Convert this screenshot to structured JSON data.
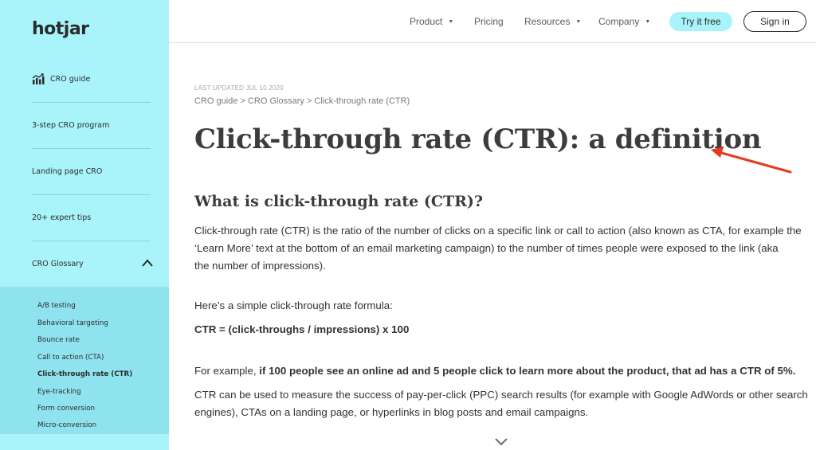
{
  "sidebar": {
    "logo": "hotjar",
    "items": [
      {
        "label": "CRO guide",
        "icon": "chart-icon"
      },
      {
        "label": "3-step CRO program"
      },
      {
        "label": "Landing page CRO"
      },
      {
        "label": "20+ expert tips"
      },
      {
        "label": "CRO Glossary",
        "icon": "chevron-up-icon"
      }
    ],
    "glossary": [
      "A/B testing",
      "Behavioral targeting",
      "Bounce rate",
      "Call to action (CTA)",
      "Click-through rate (CTR)",
      "Eye-tracking",
      "Form conversion",
      "Micro-conversion"
    ],
    "active_glossary_index": 4
  },
  "nav": {
    "product": "Product",
    "pricing": "Pricing",
    "resources": "Resources",
    "company": "Company",
    "try_free": "Try it free",
    "sign_in": "Sign in"
  },
  "article": {
    "last_updated": "LAST UPDATED JUL 10 2020",
    "breadcrumb": [
      "CRO guide",
      "CRO Glossary",
      "Click-through rate (CTR)"
    ],
    "breadcrumb_sep": ">",
    "title": "Click-through rate (CTR): a definition",
    "heading": "What is click-through rate (CTR)?",
    "p1_line1": "Click-through rate (CTR) is the ratio of the number of clicks on a specific link or call to action (also known as CTA, for example the",
    "p1_line2": "‘Learn More’ text at the bottom of an email marketing campaign) to the number of times people were exposed to the link (aka",
    "p1_line3": "the number of impressions).",
    "p2": "Here’s a simple click-through rate formula:",
    "formula": "CTR = (click-throughs / impressions) x 100",
    "p3_prefix": "For example, ",
    "p3_bold": "if 100 people see an online ad and 5 people click to learn more about the product, that ad has a CTR of 5%.",
    "p4_line1": "CTR can be used to measure the success of pay-per-click (PPC) search results (for example with Google AdWords or other search",
    "p4_line2": "engines), CTAs on a landing page, or hyperlinks in blog posts and email campaigns."
  },
  "colors": {
    "sidebar_bg": "#a9f4fb",
    "submenu_bg": "#8fe3ef",
    "annotation_arrow": "#e8391f"
  }
}
